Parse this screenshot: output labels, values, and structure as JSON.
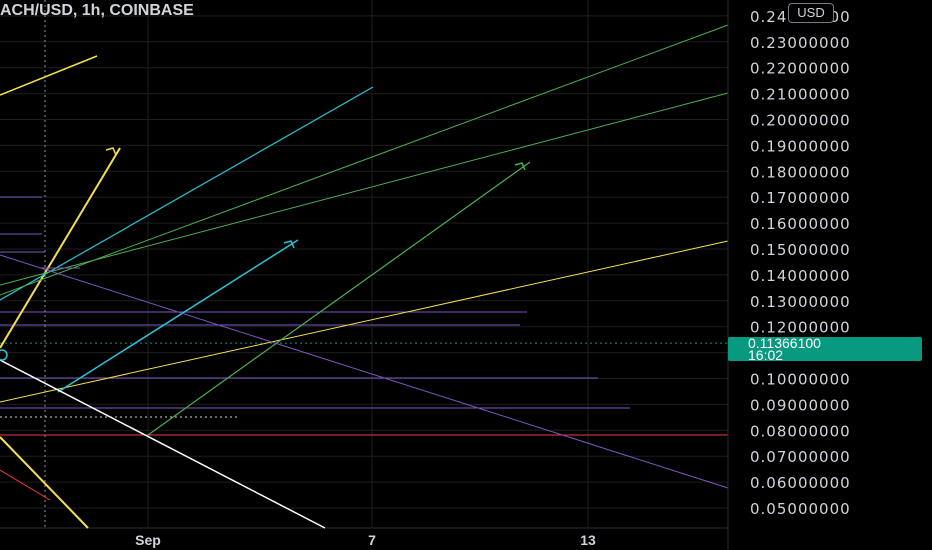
{
  "header": {
    "title": "ACH/USD, 1h, COINBASE",
    "currency": "USD"
  },
  "last_price": {
    "value": "0.11366100",
    "countdown": "16:02"
  },
  "chart_data": {
    "type": "line",
    "title": "ACH/USD, 1h, COINBASE",
    "ylim": [
      0.045,
      0.255
    ],
    "y_ticks": [
      "0.05000000",
      "0.06000000",
      "0.07000000",
      "0.08000000",
      "0.09000000",
      "0.10000000",
      "0.11000000",
      "0.12000000",
      "0.13000000",
      "0.14000000",
      "0.15000000",
      "0.16000000",
      "0.17000000",
      "0.18000000",
      "0.19000000",
      "0.20000000",
      "0.21000000",
      "0.22000000",
      "0.23000000",
      "0.24000000"
    ],
    "y_tick_values": [
      0.05,
      0.06,
      0.07,
      0.08,
      0.09,
      0.1,
      0.11,
      0.12,
      0.13,
      0.14,
      0.15,
      0.16,
      0.17,
      0.18,
      0.19,
      0.2,
      0.21,
      0.22,
      0.23,
      0.24
    ],
    "x_ticks": [
      "Sep",
      "7",
      "13"
    ],
    "last_price": 0.113661,
    "grid": true,
    "colors": {
      "background": "#000000",
      "grid": "#1e1e1e",
      "yellow": "#f5e04b",
      "cyan": "#26c6da",
      "green": "#4caf50",
      "purple": "#7e57c2",
      "white": "#ffffff",
      "red": "#f23645",
      "last_price": "#089981"
    }
  }
}
